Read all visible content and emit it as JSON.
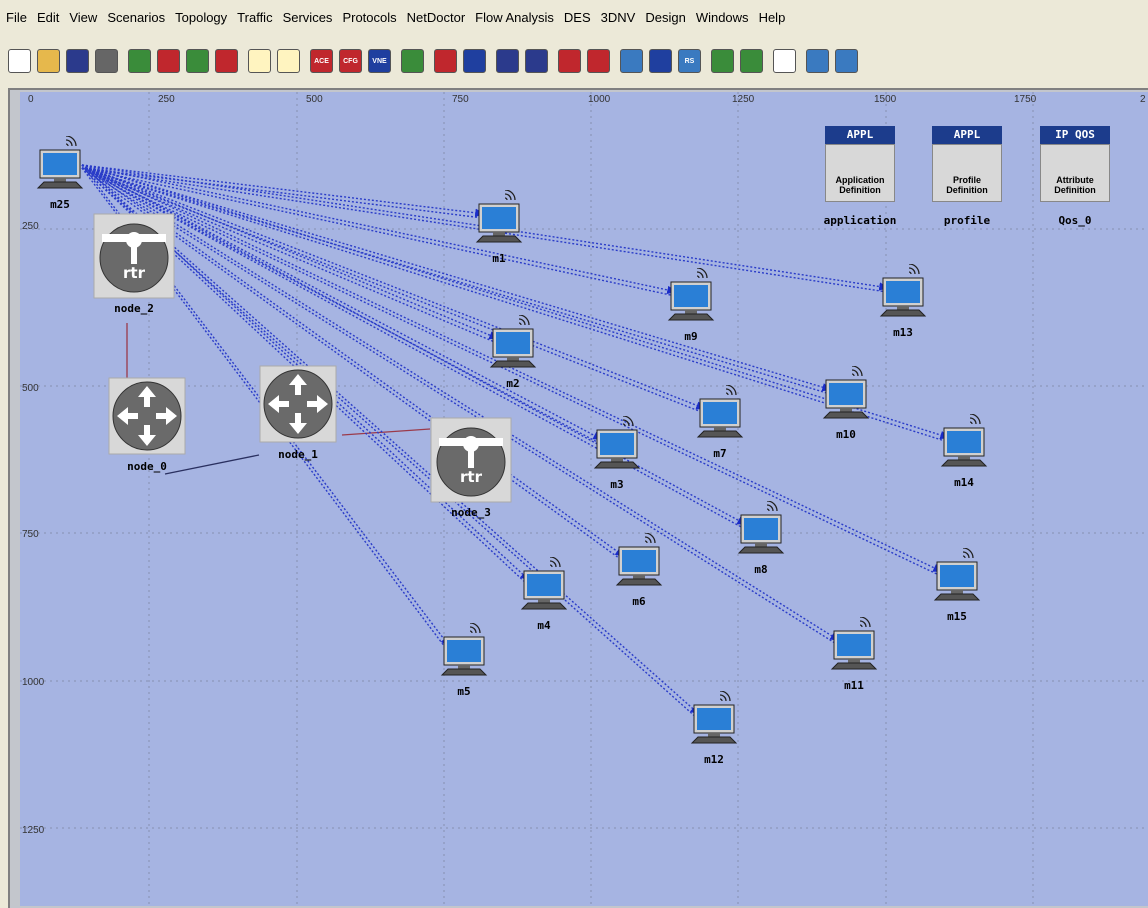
{
  "menu": [
    "File",
    "Edit",
    "View",
    "Scenarios",
    "Topology",
    "Traffic",
    "Services",
    "Protocols",
    "NetDoctor",
    "Flow Analysis",
    "DES",
    "3DNV",
    "Design",
    "Windows",
    "Help"
  ],
  "toolbar": [
    {
      "icon": "new-icon",
      "color": "#ffffff"
    },
    {
      "icon": "open-icon",
      "color": "#e6b84c"
    },
    {
      "icon": "save-icon",
      "color": "#2b3a8c"
    },
    {
      "icon": "print-icon",
      "color": "#666666"
    },
    {
      "icon": "object-palette-icon",
      "color": "#3a8c3a"
    },
    {
      "icon": "fail-node-icon",
      "color": "#c0272d"
    },
    {
      "icon": "recover-node-icon",
      "color": "#3a8c3a"
    },
    {
      "icon": "location-icon",
      "color": "#c0272d"
    },
    {
      "icon": "zoom-in-icon",
      "color": "#fff4c0"
    },
    {
      "icon": "zoom-out-icon",
      "color": "#fff4c0"
    },
    {
      "icon": "ace-icon",
      "color": "#c0272d",
      "text": "ACE"
    },
    {
      "icon": "cfg-icon",
      "color": "#c0272d",
      "text": "CFG"
    },
    {
      "icon": "vne-icon",
      "color": "#1f3f9f",
      "text": "VNE"
    },
    {
      "icon": "traffic-light-icon",
      "color": "#3a8c3a"
    },
    {
      "icon": "configure-sim-icon",
      "color": "#c0272d"
    },
    {
      "icon": "view-results-icon",
      "color": "#1f3f9f"
    },
    {
      "icon": "mesh-icon",
      "color": "#2b3a8c"
    },
    {
      "icon": "mesh-alt-icon",
      "color": "#2b3a8c"
    },
    {
      "icon": "wand-icon",
      "color": "#c0272d"
    },
    {
      "icon": "topology-icon",
      "color": "#c0272d"
    },
    {
      "icon": "network-icon",
      "color": "#3a7ac0"
    },
    {
      "icon": "flow-icon",
      "color": "#1f3f9f"
    },
    {
      "icon": "rs-icon",
      "color": "#3a7ac0",
      "text": "RS"
    },
    {
      "icon": "chart-icon",
      "color": "#3a8c3a"
    },
    {
      "icon": "report-icon",
      "color": "#3a8c3a"
    },
    {
      "icon": "info-icon",
      "color": "#ffffff"
    },
    {
      "icon": "ipv6-icon",
      "color": "#3a7ac0"
    },
    {
      "icon": "ipv6-alt-icon",
      "color": "#3a7ac0"
    }
  ],
  "rulers": {
    "x": [
      "0",
      "250",
      "500",
      "750",
      "1000",
      "1250",
      "1500",
      "1750",
      "2"
    ],
    "y": [
      "250",
      "500",
      "750",
      "1000",
      "1250"
    ]
  },
  "configs": [
    {
      "header": "APPL",
      "line1": "Application",
      "line2": "Definition",
      "label": "application"
    },
    {
      "header": "APPL",
      "line1": "Profile",
      "line2": "Definition",
      "label": "profile"
    },
    {
      "header": "IP QOS",
      "line1": "Attribute",
      "line2": "Definition",
      "label": "Qos_0"
    }
  ],
  "workstations": [
    "m25",
    "m1",
    "m9",
    "m13",
    "m2",
    "m7",
    "m10",
    "m14",
    "m3",
    "m8",
    "m15",
    "m6",
    "m4",
    "m11",
    "m5",
    "m12"
  ],
  "routers": [
    "node_0",
    "node_1"
  ],
  "servers": [
    "node_2",
    "node_3"
  ],
  "colors": {
    "canvas": "#a6b4e2",
    "link": "#2a3cc8",
    "router": "#6a6a6a",
    "monitor": "#2a7fd6",
    "server_link": "#9b3a4a"
  }
}
